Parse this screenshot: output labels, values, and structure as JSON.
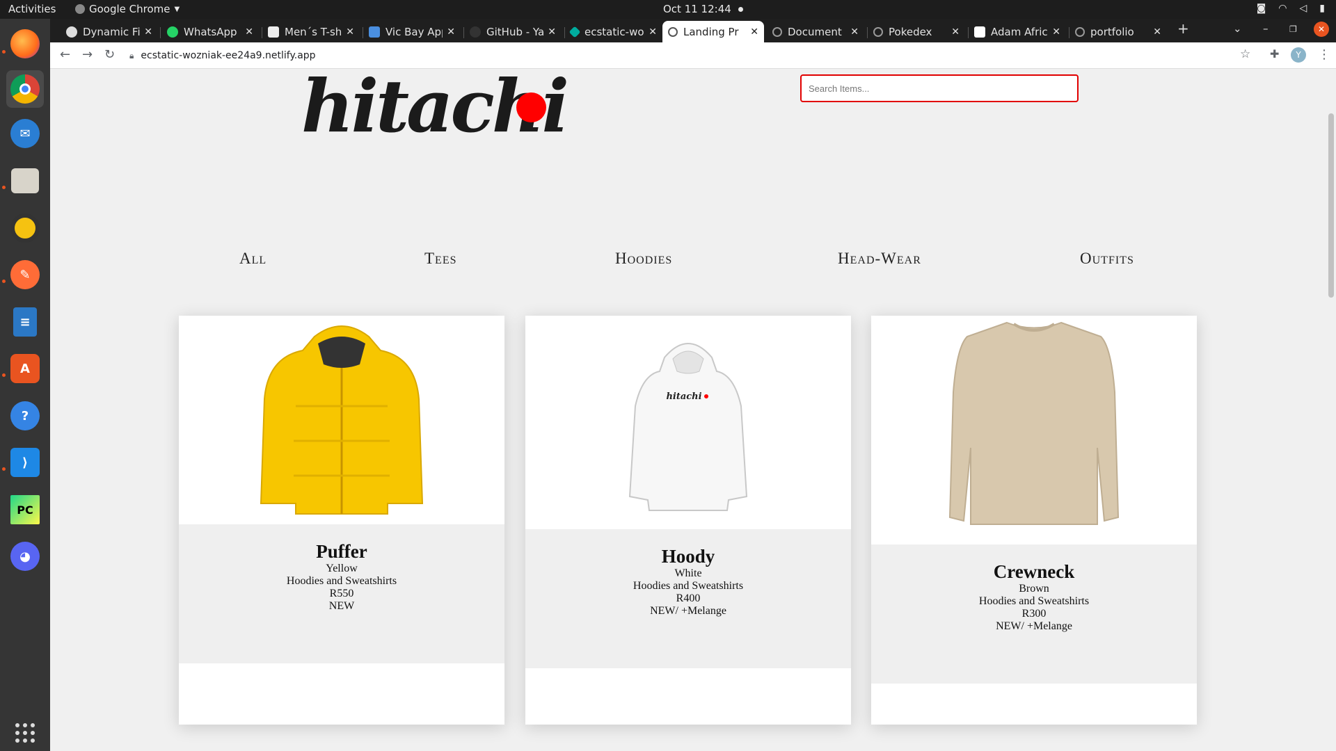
{
  "topbar": {
    "activities": "Activities",
    "app_name": "Google Chrome",
    "datetime": "Oct 11  12:44"
  },
  "tabs": [
    {
      "title": "Dynamic Fil"
    },
    {
      "title": "WhatsApp"
    },
    {
      "title": "Men´s T-shi"
    },
    {
      "title": "Vic Bay App"
    },
    {
      "title": "GitHub - Yar"
    },
    {
      "title": "ecstatic-woz"
    },
    {
      "title": "Landing Pr"
    },
    {
      "title": "Document"
    },
    {
      "title": "Pokedex"
    },
    {
      "title": "Adam Africa"
    },
    {
      "title": "portfolio"
    }
  ],
  "browser": {
    "url": "ecstatic-wozniak-ee24a9.netlify.app",
    "profile_initial": "Y"
  },
  "site": {
    "logo_text": "hitachi",
    "search_placeholder": "Search Items...",
    "categories": [
      "All",
      "Tees",
      "Hoodies",
      "Head-Wear",
      "Outfits"
    ]
  },
  "products": [
    {
      "name": "Puffer",
      "color": "Yellow",
      "category": "Hoodies and Sweatshirts",
      "price": "R550",
      "tag": "NEW"
    },
    {
      "name": "Hoody",
      "color": "White",
      "category": "Hoodies and Sweatshirts",
      "price": "R400",
      "tag": "NEW/ +Melange"
    },
    {
      "name": "Crewneck",
      "color": "Brown",
      "category": "Hoodies and Sweatshirts",
      "price": "R300",
      "tag": "NEW/ +Melange"
    }
  ],
  "colors": {
    "accent_red": "#ff0000",
    "search_border": "#e10000",
    "puffer_yellow": "#f7c600",
    "hoody_white": "#f4f4f4",
    "crewneck_beige": "#d8c8ad"
  }
}
